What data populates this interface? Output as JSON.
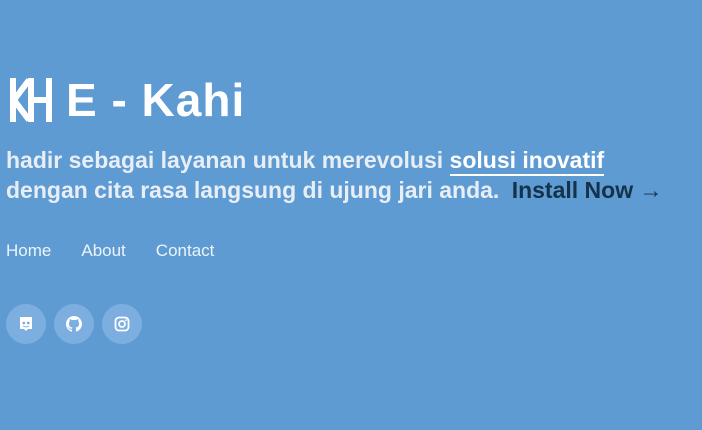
{
  "brand": {
    "name": "E - Kahi",
    "logo_icon": "kh-monogram-icon"
  },
  "tagline": {
    "prefix": "hadir sebagai layanan untuk merevolusi",
    "highlight": "solusi inovatif",
    "line2": "dengan cita rasa langsung di ujung jari anda.",
    "cta": "Install Now →"
  },
  "nav": {
    "items": [
      {
        "label": "Home"
      },
      {
        "label": "About"
      },
      {
        "label": "Contact"
      }
    ]
  },
  "social": {
    "items": [
      {
        "icon": "discord-icon"
      },
      {
        "icon": "github-icon"
      },
      {
        "icon": "instagram-icon"
      }
    ]
  },
  "colors": {
    "background": "#5e9bd3",
    "accent": "#14324a",
    "social_bg": "#7cafe0",
    "text": "#ffffff"
  }
}
